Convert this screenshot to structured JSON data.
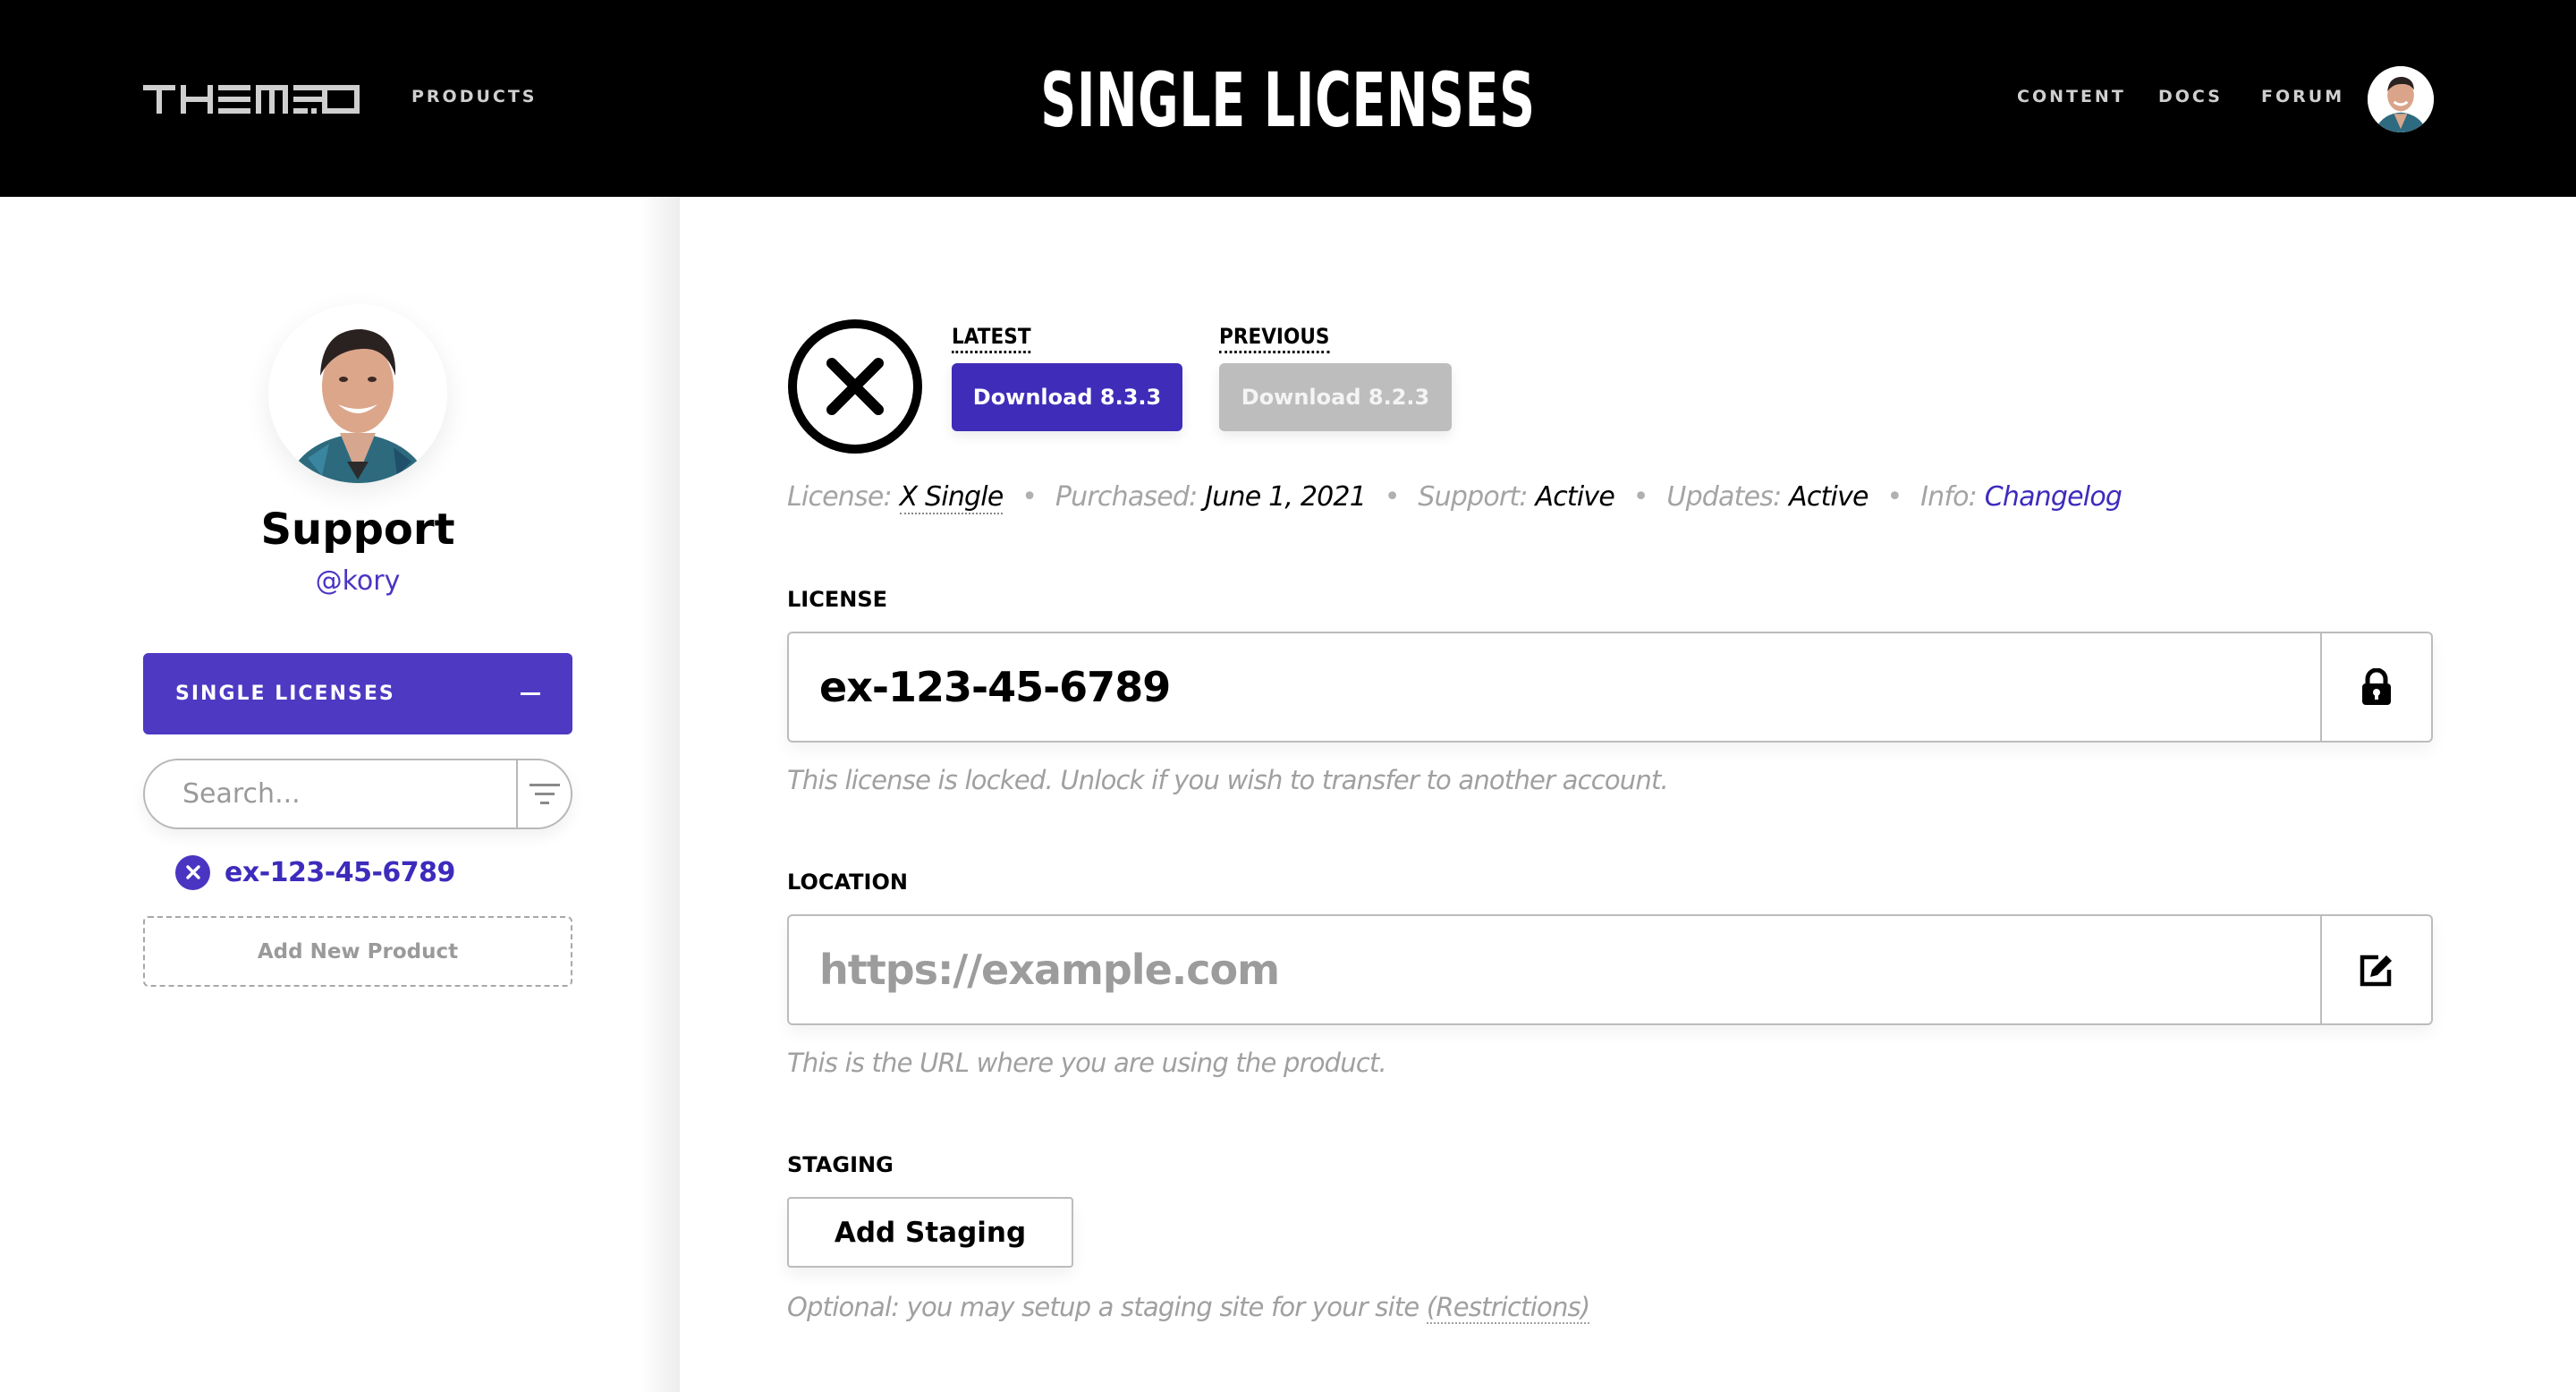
{
  "header": {
    "logo_text": "THEMECO",
    "nav_left": [
      {
        "label": "PRODUCTS"
      }
    ],
    "title": "SINGLE LICENSES",
    "nav_right": [
      {
        "label": "CONTENT"
      },
      {
        "label": "DOCS"
      },
      {
        "label": "FORUM"
      }
    ],
    "avatar_icon": "user-avatar"
  },
  "sidebar": {
    "profile": {
      "name": "Support",
      "handle": "@kory"
    },
    "section": {
      "label": "SINGLE LICENSES",
      "toggle_icon": "minus-icon"
    },
    "search": {
      "placeholder": "Search...",
      "value": "",
      "filter_icon": "filter-icon"
    },
    "licenses": [
      {
        "label": "ex-123-45-6789",
        "icon": "x-product-icon"
      }
    ],
    "add_product_label": "Add New Product"
  },
  "main": {
    "product_icon": "x-circle-icon",
    "downloads": {
      "latest": {
        "label": "LATEST",
        "button": "Download 8.3.3"
      },
      "previous": {
        "label": "PREVIOUS",
        "button": "Download 8.2.3"
      }
    },
    "meta": {
      "license_key": "License:",
      "license_val": "X Single",
      "purchased_key": "Purchased:",
      "purchased_val": "June 1, 2021",
      "support_key": "Support:",
      "support_val": "Active",
      "updates_key": "Updates:",
      "updates_val": "Active",
      "info_key": "Info:",
      "info_link": "Changelog",
      "separator": "•"
    },
    "license_field": {
      "label": "LICENSE",
      "value": "ex-123-45-6789",
      "action_icon": "lock-icon",
      "helper": "This license is locked. Unlock if you wish to transfer to another account."
    },
    "location_field": {
      "label": "LOCATION",
      "value": "",
      "placeholder": "https://example.com",
      "action_icon": "edit-icon",
      "helper": "This is the URL where you are using the product."
    },
    "staging": {
      "label": "STAGING",
      "button": "Add Staging",
      "helper_text": "Optional: you may setup a staging site for your site ",
      "helper_link": "(Restrictions)"
    }
  },
  "colors": {
    "accent": "#4e39c3",
    "accent_dark": "#3f2db9",
    "link": "#3d2bbd",
    "header_bg": "#000000",
    "disabled_button": "#bdbdbd",
    "muted_text": "#a0a0a0"
  }
}
